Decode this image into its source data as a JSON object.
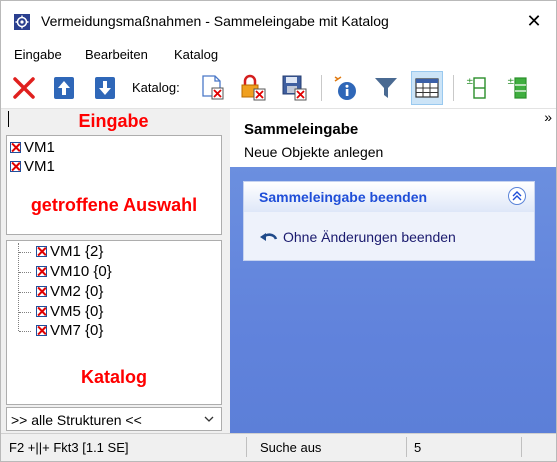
{
  "window": {
    "title": "Vermeidungsmaßnahmen - Sammeleingabe mit Katalog",
    "close_glyph": "✕"
  },
  "menu": [
    "Eingabe",
    "Bearbeiten",
    "Katalog"
  ],
  "toolbar": {
    "katalog_label": "Katalog:",
    "buttons": [
      "delete-icon",
      "move-up-icon",
      "move-down-icon",
      "catalog-remove-icon",
      "catalog-lock-remove-icon",
      "catalog-save-remove-icon",
      "info-icon",
      "filter-icon",
      "table-view-icon",
      "add-rows-icon",
      "add-column-icon"
    ]
  },
  "input_pane": {
    "title": "Eingabe",
    "selection_label": "getroffene Auswahl",
    "items": [
      "VM1",
      "VM1"
    ]
  },
  "catalog_pane": {
    "title": "Katalog",
    "items": [
      "VM1 {2}",
      "VM10 {0}",
      "VM2 {0}",
      "VM5 {0}",
      "VM7 {0}"
    ]
  },
  "structure_select": {
    "value": ">> alle Strukturen <<"
  },
  "right_panel": {
    "title": "Sammeleingabe",
    "subtitle": "Neue Objekte anlegen",
    "collapse_glyph": "»",
    "task": {
      "header": "Sammeleingabe beenden",
      "header_glyph": "⌃",
      "link": "Ohne Änderungen beenden"
    }
  },
  "status": {
    "keys": "F2 +||+ Fkt3 [1.1 SE]",
    "search": "Suche aus",
    "count": "5"
  },
  "colors": {
    "label_red": "#ff0000",
    "panel_blue": "#6183dc",
    "link_blue": "#1f4ed8"
  }
}
